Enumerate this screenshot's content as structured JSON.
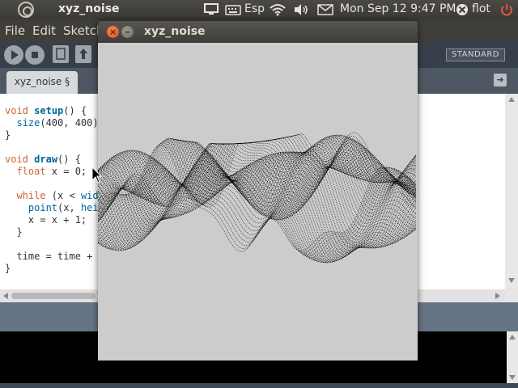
{
  "top_panel": {
    "app_title": "xyz_noise",
    "keyboard_layout": "Esp",
    "datetime": "Mon Sep 12  9:47 PM",
    "user": "flot",
    "icons": [
      "ubuntu-logo-icon",
      "display-icon",
      "keyboard-icon",
      "wifi-icon",
      "volume-icon",
      "mail-icon",
      "user-status-icon",
      "power-icon"
    ]
  },
  "menubar": {
    "items": [
      "File",
      "Edit",
      "Sketch"
    ]
  },
  "toolbar": {
    "mode": "STANDARD",
    "buttons": [
      "run-icon",
      "stop-icon",
      "new-icon",
      "open-icon"
    ]
  },
  "tabs": {
    "sketch_tab": "xyz_noise §"
  },
  "editor": {
    "lines": [
      "void setup() {",
      "  size(400, 400)",
      "}",
      "",
      "void draw() {",
      "  float x = 0;",
      "",
      "  while (x < wid",
      "    point(x, hei",
      "    x = x + 1;",
      "  }",
      "",
      "  time = time + (",
      "}"
    ]
  },
  "sketch_window": {
    "title": "xyz_noise",
    "background": "#cccccc",
    "stroke": "#000000"
  }
}
